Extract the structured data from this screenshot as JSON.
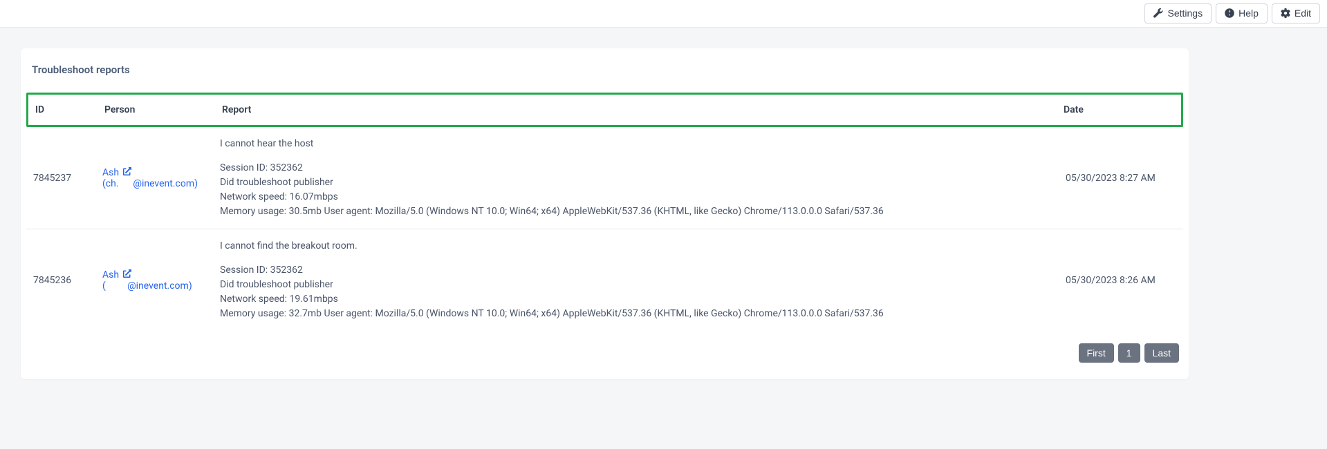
{
  "topbar": {
    "settings": "Settings",
    "help": "Help",
    "edit": "Edit"
  },
  "card": {
    "title": "Troubleshoot reports"
  },
  "columns": {
    "id": "ID",
    "person": "Person",
    "report": "Report",
    "date": "Date"
  },
  "rows": [
    {
      "id": "7845237",
      "person_name": "Ash",
      "person_line2": "(ch.",
      "person_domain": "@inevent.com)",
      "issue": "I cannot hear the host",
      "session_line": "Session ID: 352362",
      "did_line": "Did troubleshoot publisher",
      "net_line": "Network speed: 16.07mbps",
      "mem_line": "Memory usage: 30.5mb User agent: Mozilla/5.0 (Windows NT 10.0; Win64; x64) AppleWebKit/537.36 (KHTML, like Gecko) Chrome/113.0.0.0 Safari/537.36",
      "date": "05/30/2023 8:27 AM"
    },
    {
      "id": "7845236",
      "person_name": "Ash",
      "person_line2": "(",
      "person_domain": "@inevent.com)",
      "issue": "I cannot find the breakout room.",
      "session_line": "Session ID: 352362",
      "did_line": "Did troubleshoot publisher",
      "net_line": "Network speed: 19.61mbps",
      "mem_line": "Memory usage: 32.7mb User agent: Mozilla/5.0 (Windows NT 10.0; Win64; x64) AppleWebKit/537.36 (KHTML, like Gecko) Chrome/113.0.0.0 Safari/537.36",
      "date": "05/30/2023 8:26 AM"
    }
  ],
  "pager": {
    "first": "First",
    "page": "1",
    "last": "Last"
  }
}
